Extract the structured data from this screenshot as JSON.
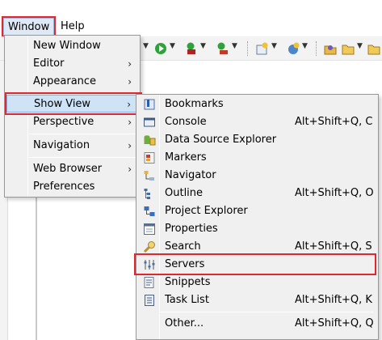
{
  "menubar": {
    "window_label": "Window",
    "help_label": "Help"
  },
  "toolbar": {
    "icons": [
      "debug-icon",
      "run-icon",
      "external-tools-icon",
      "coverage-icon",
      "new-wizard-icon",
      "new-server-icon",
      "open-type-icon",
      "open-folder-icon"
    ]
  },
  "window_menu": {
    "items": [
      {
        "label": "New Window",
        "submenu": false
      },
      {
        "label": "Editor",
        "submenu": true
      },
      {
        "label": "Appearance",
        "submenu": true
      },
      {
        "label": "Show View",
        "submenu": true
      },
      {
        "label": "Perspective",
        "submenu": true
      },
      {
        "label": "Navigation",
        "submenu": true
      },
      {
        "label": "Web Browser",
        "submenu": true
      },
      {
        "label": "Preferences",
        "submenu": false
      }
    ],
    "submenu_arrow": "›",
    "highlighted": "Show View"
  },
  "show_view_menu": {
    "items": [
      {
        "label": "Bookmarks",
        "shortcut": "",
        "icon": "bookmarks-icon"
      },
      {
        "label": "Console",
        "shortcut": "Alt+Shift+Q, C",
        "icon": "console-icon"
      },
      {
        "label": "Data Source Explorer",
        "shortcut": "",
        "icon": "data-source-icon"
      },
      {
        "label": "Markers",
        "shortcut": "",
        "icon": "markers-icon"
      },
      {
        "label": "Navigator",
        "shortcut": "",
        "icon": "navigator-icon"
      },
      {
        "label": "Outline",
        "shortcut": "Alt+Shift+Q, O",
        "icon": "outline-icon"
      },
      {
        "label": "Project Explorer",
        "shortcut": "",
        "icon": "project-explorer-icon"
      },
      {
        "label": "Properties",
        "shortcut": "",
        "icon": "properties-icon"
      },
      {
        "label": "Search",
        "shortcut": "Alt+Shift+Q, S",
        "icon": "search-icon"
      },
      {
        "label": "Servers",
        "shortcut": "",
        "icon": "servers-icon"
      },
      {
        "label": "Snippets",
        "shortcut": "",
        "icon": "snippets-icon"
      },
      {
        "label": "Task List",
        "shortcut": "Alt+Shift+Q, K",
        "icon": "task-list-icon"
      },
      {
        "label": "Other...",
        "shortcut": "Alt+Shift+Q, Q",
        "icon": ""
      }
    ],
    "highlighted": "Servers"
  },
  "colors": {
    "highlight_outline": "#e0262e",
    "menu_bg": "#f0f0f0",
    "hover_bg": "#cfe3f7"
  }
}
